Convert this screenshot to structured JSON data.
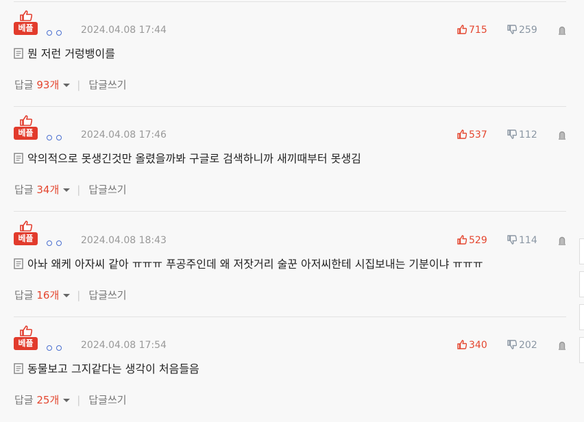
{
  "best_label": "베플",
  "reply_label": "답글",
  "reply_unit": "개",
  "write_reply_label": "답글쓰기",
  "colors": {
    "accent": "#e4462f",
    "downvote": "#8a96a3",
    "nick_icon": "#4a6fd0"
  },
  "comments": [
    {
      "date": "2024.04.08 17:44",
      "up": "715",
      "down": "259",
      "text": "뭔 저런 거렁뱅이를",
      "replies": "93"
    },
    {
      "date": "2024.04.08 17:46",
      "up": "537",
      "down": "112",
      "text": "악의적으로 못생긴것만 올렸을까봐 구글로 검색하니까 새끼때부터 못생김",
      "replies": "34"
    },
    {
      "date": "2024.04.08 18:43",
      "up": "529",
      "down": "114",
      "text": "아놔 왜케 아자씨 같아 ㅠㅠㅠ 푸공주인데 왜 저잣거리 술꾼 아저씨한테 시집보내는 기분이냐 ㅠㅠㅠ",
      "replies": "16"
    },
    {
      "date": "2024.04.08 17:54",
      "up": "340",
      "down": "202",
      "text": "동물보고 그지같다는 생각이 처음들음",
      "replies": "25"
    }
  ]
}
